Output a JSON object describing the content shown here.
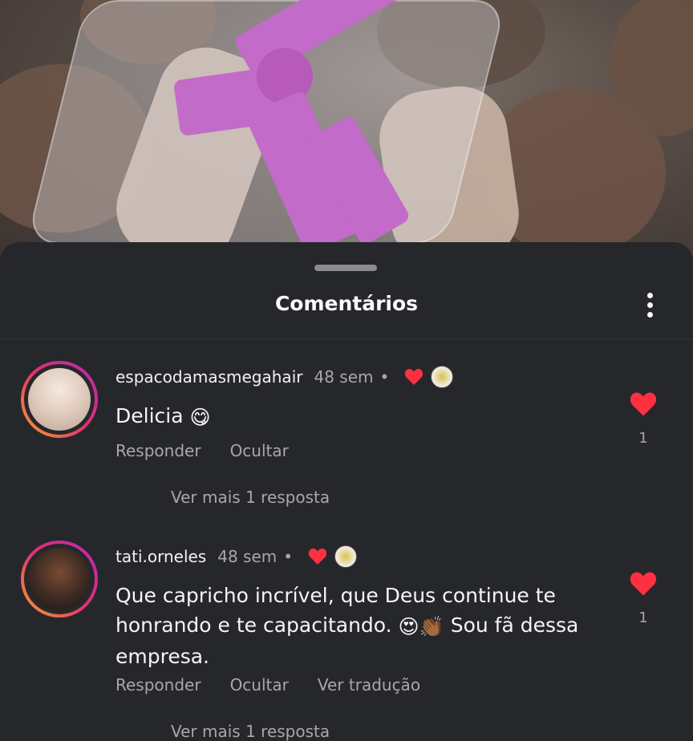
{
  "sheet": {
    "title": "Comentários"
  },
  "comments": [
    {
      "username": "espacodamasmegahair",
      "time": "48 sem",
      "separator": "•",
      "text": "Delicia",
      "emoji": "😋",
      "actions": [
        "Responder",
        "Ocultar"
      ],
      "more": "Ver mais 1 resposta",
      "likes": "1"
    },
    {
      "username": "tati.orneles",
      "time": "48 sem",
      "separator": "•",
      "text_line1": "Que capricho incrível, que Deus continue te",
      "text_line2a": "honrando e te capacitando.",
      "emoji_a": "😍",
      "emoji_b": "👏🏾",
      "text_line2b": "Sou fã dessa",
      "text_line3": "empresa.",
      "actions": [
        "Responder",
        "Ocultar",
        "Ver tradução"
      ],
      "more": "Ver mais 1 resposta",
      "likes": "1"
    }
  ],
  "colors": {
    "like": "#ff3040",
    "background": "#26272b",
    "secondary_text": "#a7a7ad"
  },
  "icons": [
    "more-options-icon",
    "heart-icon",
    "creator-heart-icon"
  ]
}
